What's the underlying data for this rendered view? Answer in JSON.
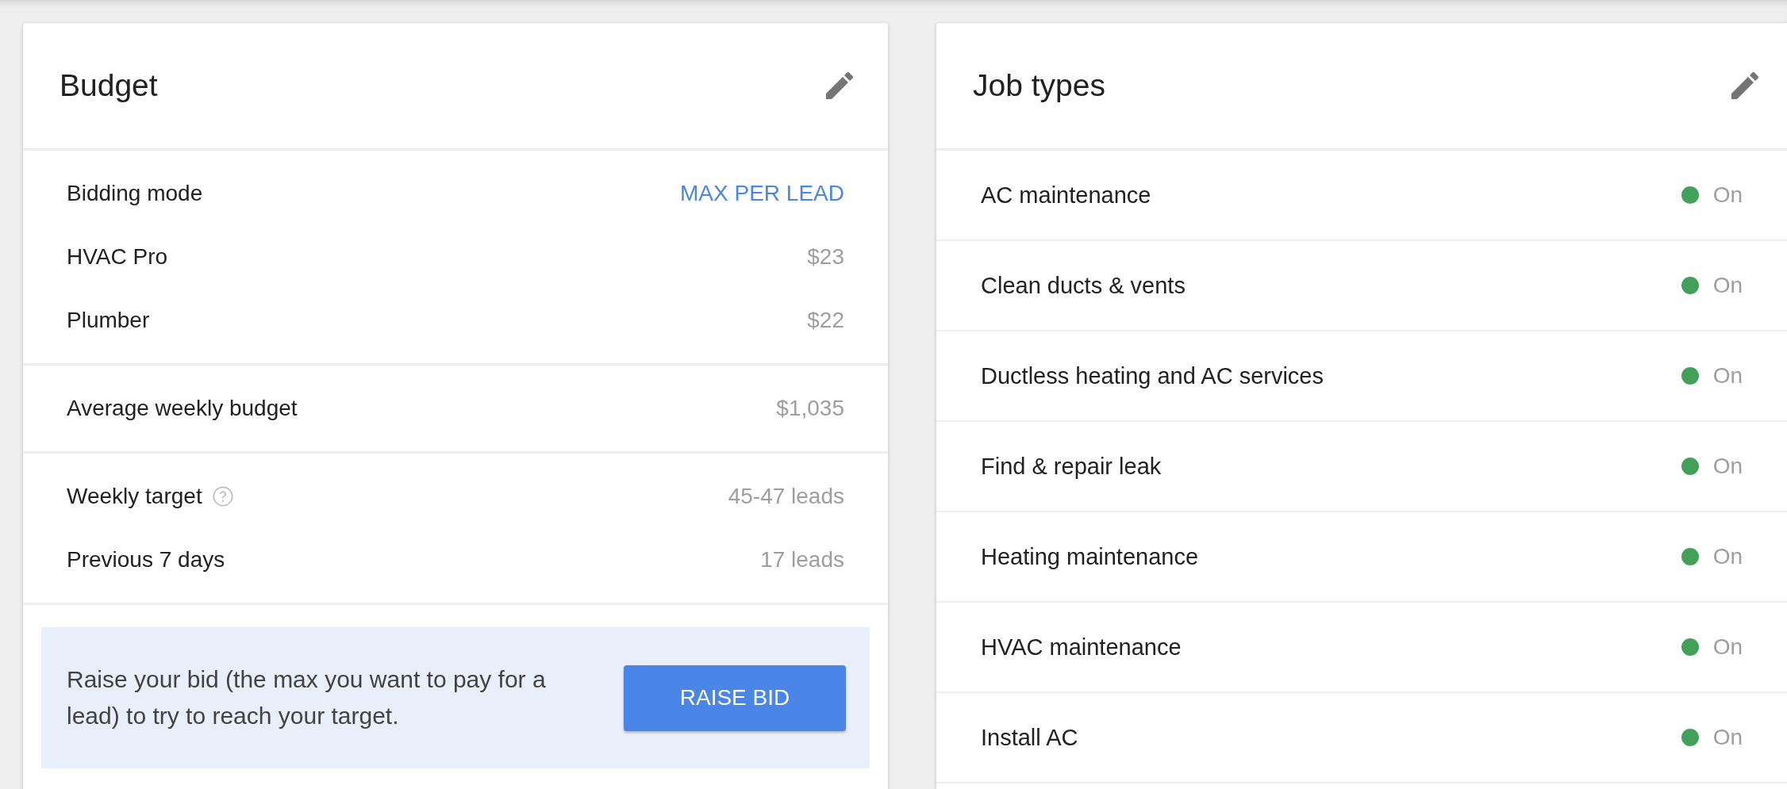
{
  "budget": {
    "title": "Budget",
    "sections": [
      {
        "rows": [
          {
            "label": "Bidding mode",
            "value": "MAX PER LEAD",
            "kind": "link",
            "help": false
          },
          {
            "label": "HVAC Pro",
            "value": "$23",
            "kind": "value",
            "help": false
          },
          {
            "label": "Plumber",
            "value": "$22",
            "kind": "value",
            "help": false
          }
        ]
      },
      {
        "rows": [
          {
            "label": "Average weekly budget",
            "value": "$1,035",
            "kind": "value",
            "help": false
          }
        ]
      },
      {
        "rows": [
          {
            "label": "Weekly target",
            "value": "45-47 leads",
            "kind": "value",
            "help": true
          },
          {
            "label": "Previous 7 days",
            "value": "17 leads",
            "kind": "value",
            "help": false
          }
        ]
      }
    ],
    "banner": {
      "text": "Raise your bid (the max you want to pay for a lead) to try to reach your target.",
      "button": "RAISE BID"
    }
  },
  "job_types": {
    "title": "Job types",
    "items": [
      {
        "name": "AC maintenance",
        "status": "On",
        "on": true
      },
      {
        "name": "Clean ducts & vents",
        "status": "On",
        "on": true
      },
      {
        "name": "Ductless heating and AC services",
        "status": "On",
        "on": true
      },
      {
        "name": "Find & repair leak",
        "status": "On",
        "on": true
      },
      {
        "name": "Heating maintenance",
        "status": "On",
        "on": true
      },
      {
        "name": "HVAC maintenance",
        "status": "On",
        "on": true
      },
      {
        "name": "Install AC",
        "status": "On",
        "on": true
      }
    ]
  }
}
